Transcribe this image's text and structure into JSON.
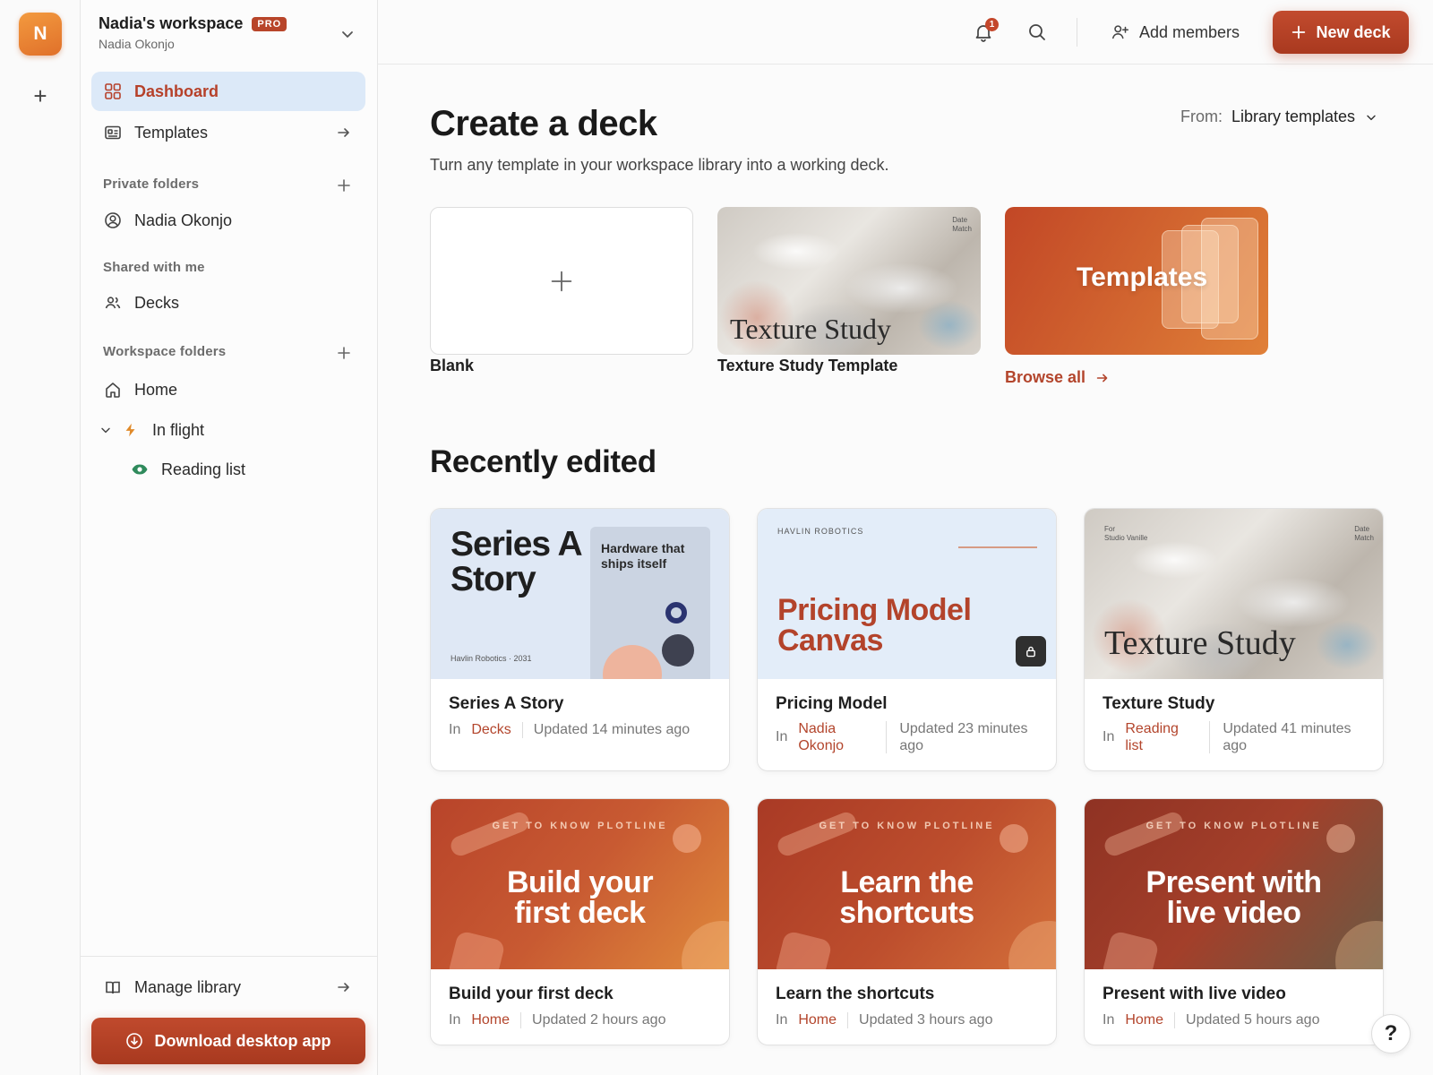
{
  "rail": {
    "avatar_letter": "N",
    "add_label": "+"
  },
  "workspace": {
    "name": "Nadia's workspace",
    "badge": "PRO",
    "user": "Nadia Okonjo"
  },
  "nav": {
    "dashboard": "Dashboard",
    "templates": "Templates",
    "private_label": "Private folders",
    "private_item": "Nadia Okonjo",
    "shared_label": "Shared with me",
    "shared_item": "Decks",
    "workspace_label": "Workspace folders",
    "home": "Home",
    "in_flight": "In flight",
    "reading_list": "Reading list"
  },
  "footer": {
    "manage_library": "Manage library",
    "download": "Download desktop app"
  },
  "topbar": {
    "notification_count": "1",
    "add_members": "Add members",
    "new_deck": "New deck"
  },
  "create": {
    "title": "Create a deck",
    "subtitle": "Turn any template in your workspace library into a working deck.",
    "from_label": "From:",
    "from_value": "Library templates",
    "blank": "Blank",
    "texture_caption": "Texture Study Template",
    "texture_art_label": "Texture Study",
    "texture_corner": "Date\nMatch",
    "templates_art_label": "Templates",
    "browse_all": "Browse all"
  },
  "recent": {
    "title": "Recently edited",
    "in_label": "In",
    "cards": [
      {
        "title": "Series A Story",
        "location": "Decks",
        "updated": "Updated 14 minutes ago",
        "thumb_big": "Series A Story",
        "thumb_panel": "Hardware that ships itself",
        "thumb_foot": "Havlin Robotics · 2031"
      },
      {
        "title": "Pricing Model",
        "location": "Nadia Okonjo",
        "updated": "Updated 23 minutes ago",
        "thumb_brand": "HAVLIN ROBOTICS",
        "thumb_big": "Pricing Model Canvas"
      },
      {
        "title": "Texture Study",
        "location": "Reading list",
        "updated": "Updated 41 minutes ago",
        "thumb_big": "Texture Study",
        "thumb_corner_left": "For\nStudio Vanille",
        "thumb_corner_right": "Date\nMatch"
      },
      {
        "title": "Build your first deck",
        "location": "Home",
        "updated": "Updated 2 hours ago",
        "thumb_eyebrow": "GET TO KNOW PLOTLINE",
        "thumb_big": "Build your first deck"
      },
      {
        "title": "Learn the shortcuts",
        "location": "Home",
        "updated": "Updated 3 hours ago",
        "thumb_eyebrow": "GET TO KNOW PLOTLINE",
        "thumb_big": "Learn the shortcuts"
      },
      {
        "title": "Present with live video",
        "location": "Home",
        "updated": "Updated 5 hours ago",
        "thumb_eyebrow": "GET TO KNOW PLOTLINE",
        "thumb_big": "Present with live video"
      }
    ]
  },
  "help_label": "?",
  "colors": {
    "accent": "#b3452c",
    "active_nav_bg": "#dce9f8"
  }
}
